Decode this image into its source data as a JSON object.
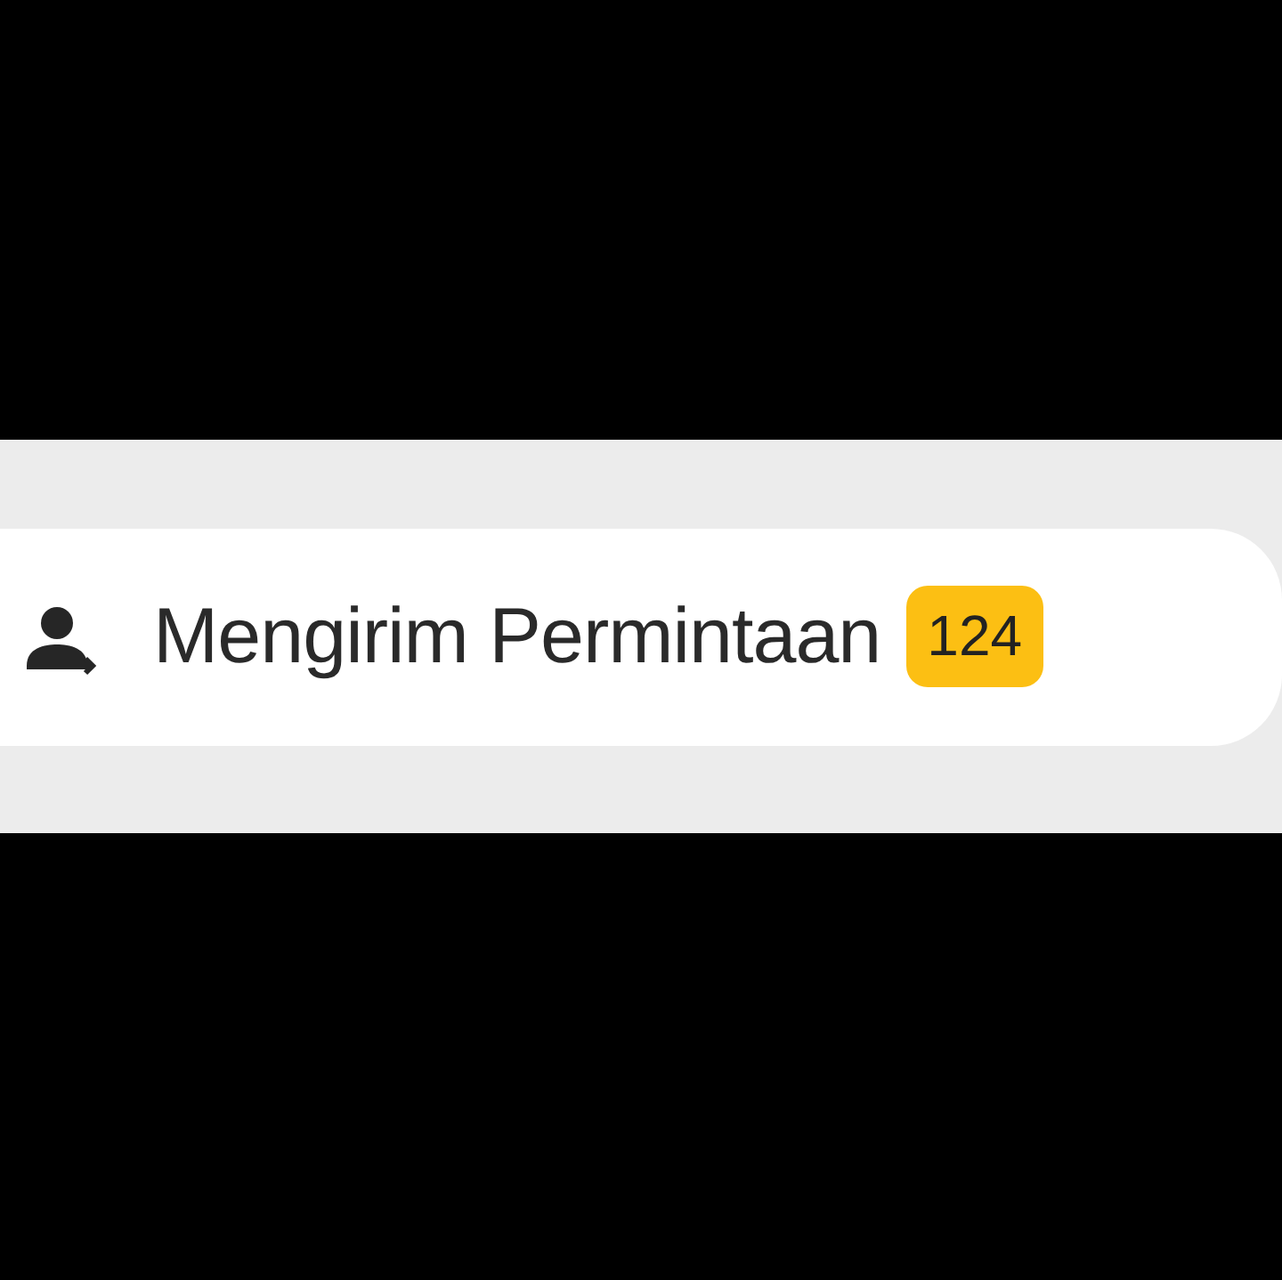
{
  "menu_item": {
    "label": "Mengirim Permintaan",
    "badge": "124"
  }
}
